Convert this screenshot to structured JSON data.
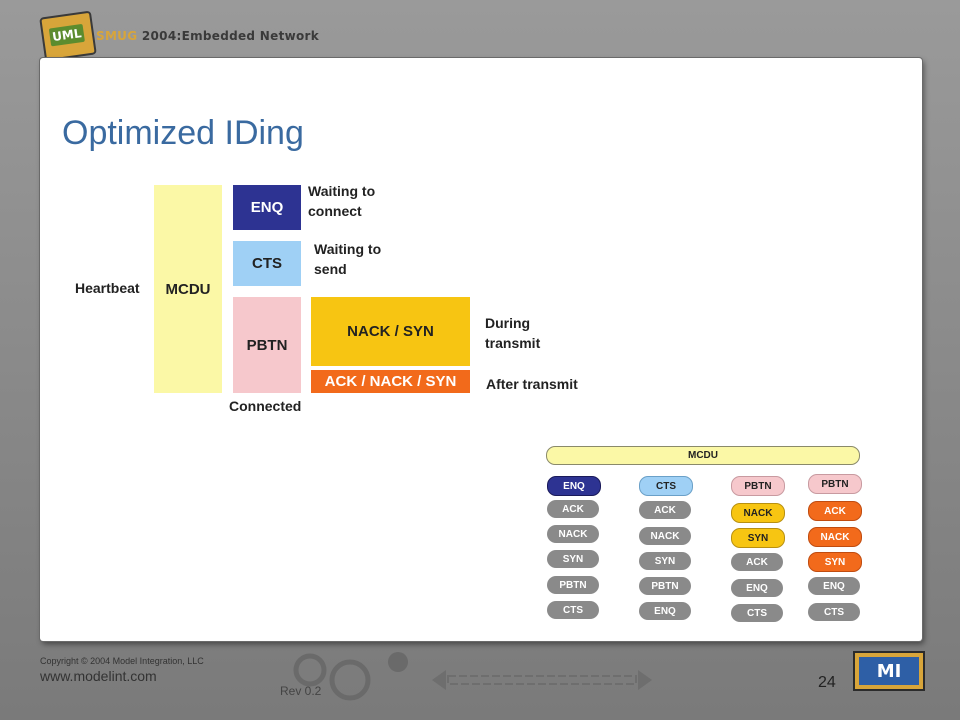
{
  "header": {
    "logo_text": "UML",
    "brand_prefix": "SMUG",
    "brand_year": " 2004:",
    "brand_rest": "Embedded Network"
  },
  "slide": {
    "title": "Optimized IDing",
    "diagram": {
      "heartbeat": "Heartbeat",
      "mcdu": "MCDU",
      "enq": "ENQ",
      "cts": "CTS",
      "pbtn": "PBTN",
      "nack_syn": "NACK / SYN",
      "ack_nack_syn": "ACK / NACK / SYN",
      "waiting_connect": "Waiting to connect",
      "waiting_send": "Waiting to send",
      "during_transmit": "During transmit",
      "after_transmit": "After transmit",
      "connected": "Connected"
    },
    "state_table": {
      "header": "MCDU",
      "columns": [
        [
          "ENQ",
          "ACK",
          "NACK",
          "SYN",
          "PBTN",
          "CTS"
        ],
        [
          "CTS",
          "ACK",
          "NACK",
          "SYN",
          "PBTN",
          "ENQ"
        ],
        [
          "PBTN",
          "NACK",
          "SYN",
          "ACK",
          "ENQ",
          "CTS"
        ],
        [
          "PBTN",
          "ACK",
          "NACK",
          "SYN",
          "ENQ",
          "CTS"
        ]
      ],
      "colors": {
        "navy": "#2d3392",
        "light_blue": "#9fd0f5",
        "pink": "#f6c8cc",
        "yellow": "#f7c512",
        "orange": "#f26a1b",
        "gray": "#8a8a8a"
      }
    }
  },
  "footer": {
    "copyright": "Copyright © 2004 Model Integration, LLC",
    "url": "www.modelint.com",
    "rev": "Rev 0.2",
    "page": "24",
    "logo_text": "MI"
  }
}
